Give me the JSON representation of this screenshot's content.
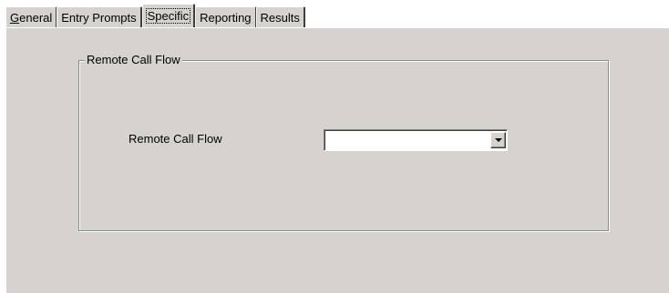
{
  "tabs": [
    {
      "label_mnemonic": "G",
      "label_rest": "eneral",
      "active": false
    },
    {
      "label": "Entry Prompts",
      "active": false
    },
    {
      "label": "Specific",
      "active": true
    },
    {
      "label": "Reporting",
      "active": false
    },
    {
      "label": "Results",
      "active": false
    }
  ],
  "group": {
    "title": "Remote Call Flow",
    "field_label": "Remote Call Flow",
    "combo": {
      "value": "",
      "icon": "chevron-down-icon"
    }
  },
  "colors": {
    "face": "#d6d3ce",
    "highlight": "#ffffff",
    "shadow": "#808080",
    "dark_shadow": "#404040"
  }
}
